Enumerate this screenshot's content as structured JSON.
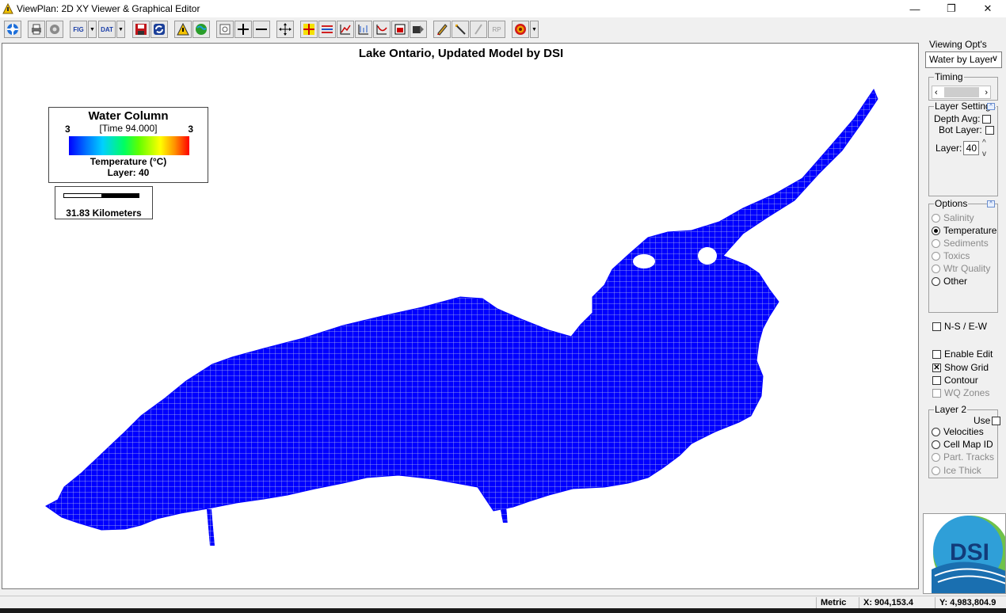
{
  "window": {
    "title": "ViewPlan: 2D XY Viewer & Graphical Editor",
    "controls": [
      "—",
      "❐",
      "✕"
    ]
  },
  "toolbar": {
    "buttons": [
      {
        "name": "navigate",
        "icon": "target-icon"
      },
      {
        "name": "print",
        "icon": "printer-icon"
      },
      {
        "name": "settings",
        "icon": "gear-icon"
      },
      {
        "name": "fig",
        "label": "FIG"
      },
      {
        "name": "dat",
        "label": "DAT"
      },
      {
        "name": "save",
        "icon": "floppy-icon"
      },
      {
        "name": "refresh",
        "icon": "refresh-icon"
      },
      {
        "name": "warning",
        "icon": "warning-icon"
      },
      {
        "name": "globe",
        "icon": "globe-icon"
      },
      {
        "name": "zoom-extent",
        "icon": "zoom-extent-icon"
      },
      {
        "name": "zoom-in",
        "icon": "plus-icon"
      },
      {
        "name": "zoom-out",
        "icon": "minus-icon"
      },
      {
        "name": "pan",
        "icon": "move-icon"
      },
      {
        "name": "crosshair",
        "icon": "crosshair-icon"
      },
      {
        "name": "layers",
        "icon": "layers-icon"
      },
      {
        "name": "chart-edit",
        "icon": "chart-edit-icon"
      },
      {
        "name": "time-series",
        "icon": "time-series-icon"
      },
      {
        "name": "profile",
        "icon": "profile-icon"
      },
      {
        "name": "cross-section",
        "icon": "cross-section-icon"
      },
      {
        "name": "export",
        "icon": "export-icon"
      },
      {
        "name": "pencil",
        "icon": "pencil-icon"
      },
      {
        "name": "wand",
        "icon": "wand-icon"
      },
      {
        "name": "draw-disabled",
        "icon": "pen-disabled-icon"
      },
      {
        "name": "rp",
        "label": "RP"
      },
      {
        "name": "options",
        "icon": "target-options-icon"
      }
    ],
    "fig_label": "FIG",
    "dat_label": "DAT",
    "rp_label": "RP"
  },
  "canvas": {
    "title": "Lake Ontario, Updated Model by DSI",
    "legend": {
      "heading": "Water Column",
      "time": "[Time 94.000]",
      "min": "3",
      "max": "3",
      "variable": "Temperature (°C)",
      "layer": "Layer: 40"
    },
    "scale": {
      "label": "31.83 Kilometers"
    },
    "lake_color": "#0000ff",
    "grid_color": "#b7bfe6"
  },
  "side_panel": {
    "viewing_label": "Viewing Opt's",
    "viewing_select": "Water by Layer",
    "timing_label": "Timing",
    "layer_settings_label": "Layer Settings",
    "depth_avg_label": "Depth Avg:",
    "bot_layer_label": "Bot Layer:",
    "layer_label": "Layer:",
    "layer_value": "40",
    "options_label": "Options",
    "options": [
      {
        "label": "Salinity",
        "selected": false,
        "enabled": false
      },
      {
        "label": "Temperature",
        "selected": true,
        "enabled": true
      },
      {
        "label": "Sediments",
        "selected": false,
        "enabled": false
      },
      {
        "label": "Toxics",
        "selected": false,
        "enabled": false
      },
      {
        "label": "Wtr Quality",
        "selected": false,
        "enabled": false
      },
      {
        "label": "Other",
        "selected": false,
        "enabled": true
      }
    ],
    "ns_ew_label": "N-S / E-W",
    "enable_edit_label": "Enable Edit",
    "show_grid_label": "Show Grid",
    "contour_label": "Contour",
    "wq_zones_label": "WQ Zones",
    "layer2_label": "Layer 2",
    "use_label": "Use",
    "layer2_options": [
      {
        "label": "Velocities",
        "enabled": true
      },
      {
        "label": "Cell Map ID",
        "enabled": true
      },
      {
        "label": "Part. Tracks",
        "enabled": false
      },
      {
        "label": "Ice Thick",
        "enabled": false
      }
    ],
    "logo_text": "DSI"
  },
  "status": {
    "units": "Metric",
    "x": "X: 904,153.4",
    "y": "Y: 4,983,804.9"
  }
}
